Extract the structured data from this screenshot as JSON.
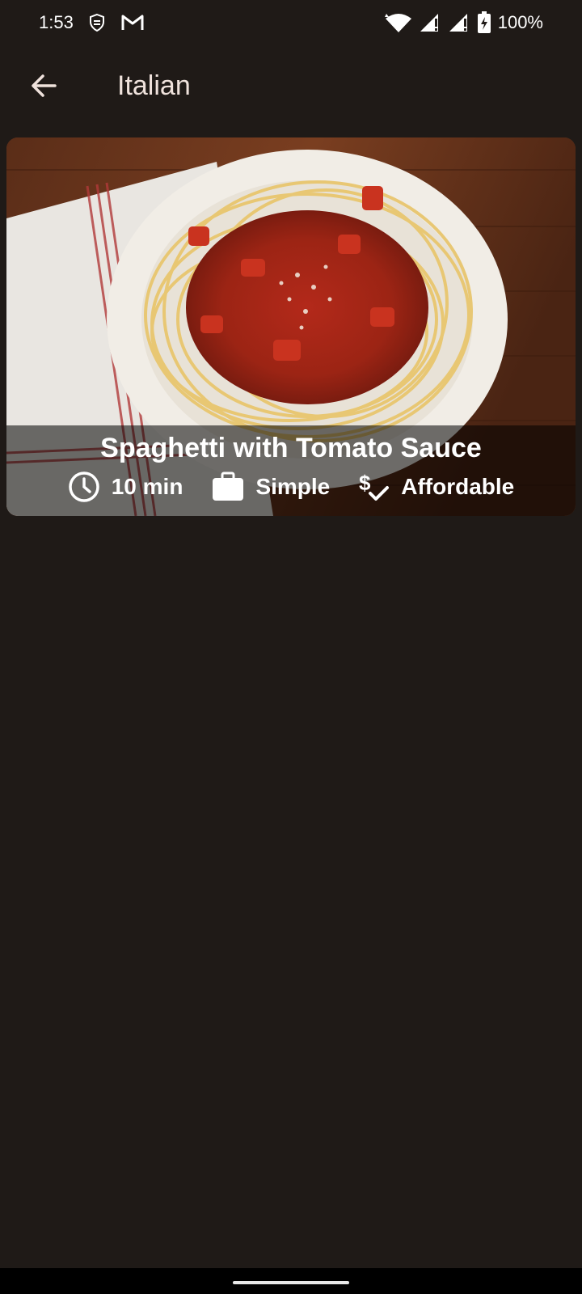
{
  "status_bar": {
    "time": "1:53",
    "battery": "100%",
    "icons": [
      "security-shield-icon",
      "gmail-icon",
      "wifi-icon",
      "signal-icon",
      "signal-icon",
      "battery-charging-icon"
    ]
  },
  "app_bar": {
    "back_icon": "arrow-back-icon",
    "title": "Italian"
  },
  "meal": {
    "title": "Spaghetti with Tomato Sauce",
    "duration": "10 min",
    "complexity": "Simple",
    "affordability": "Affordable",
    "icons": {
      "duration": "clock-icon",
      "complexity": "briefcase-icon",
      "affordability": "dollar-check-icon"
    }
  },
  "colors": {
    "background": "#1f1a17",
    "title": "#efe2dc",
    "overlay": "rgba(0,0,0,0.55)"
  }
}
